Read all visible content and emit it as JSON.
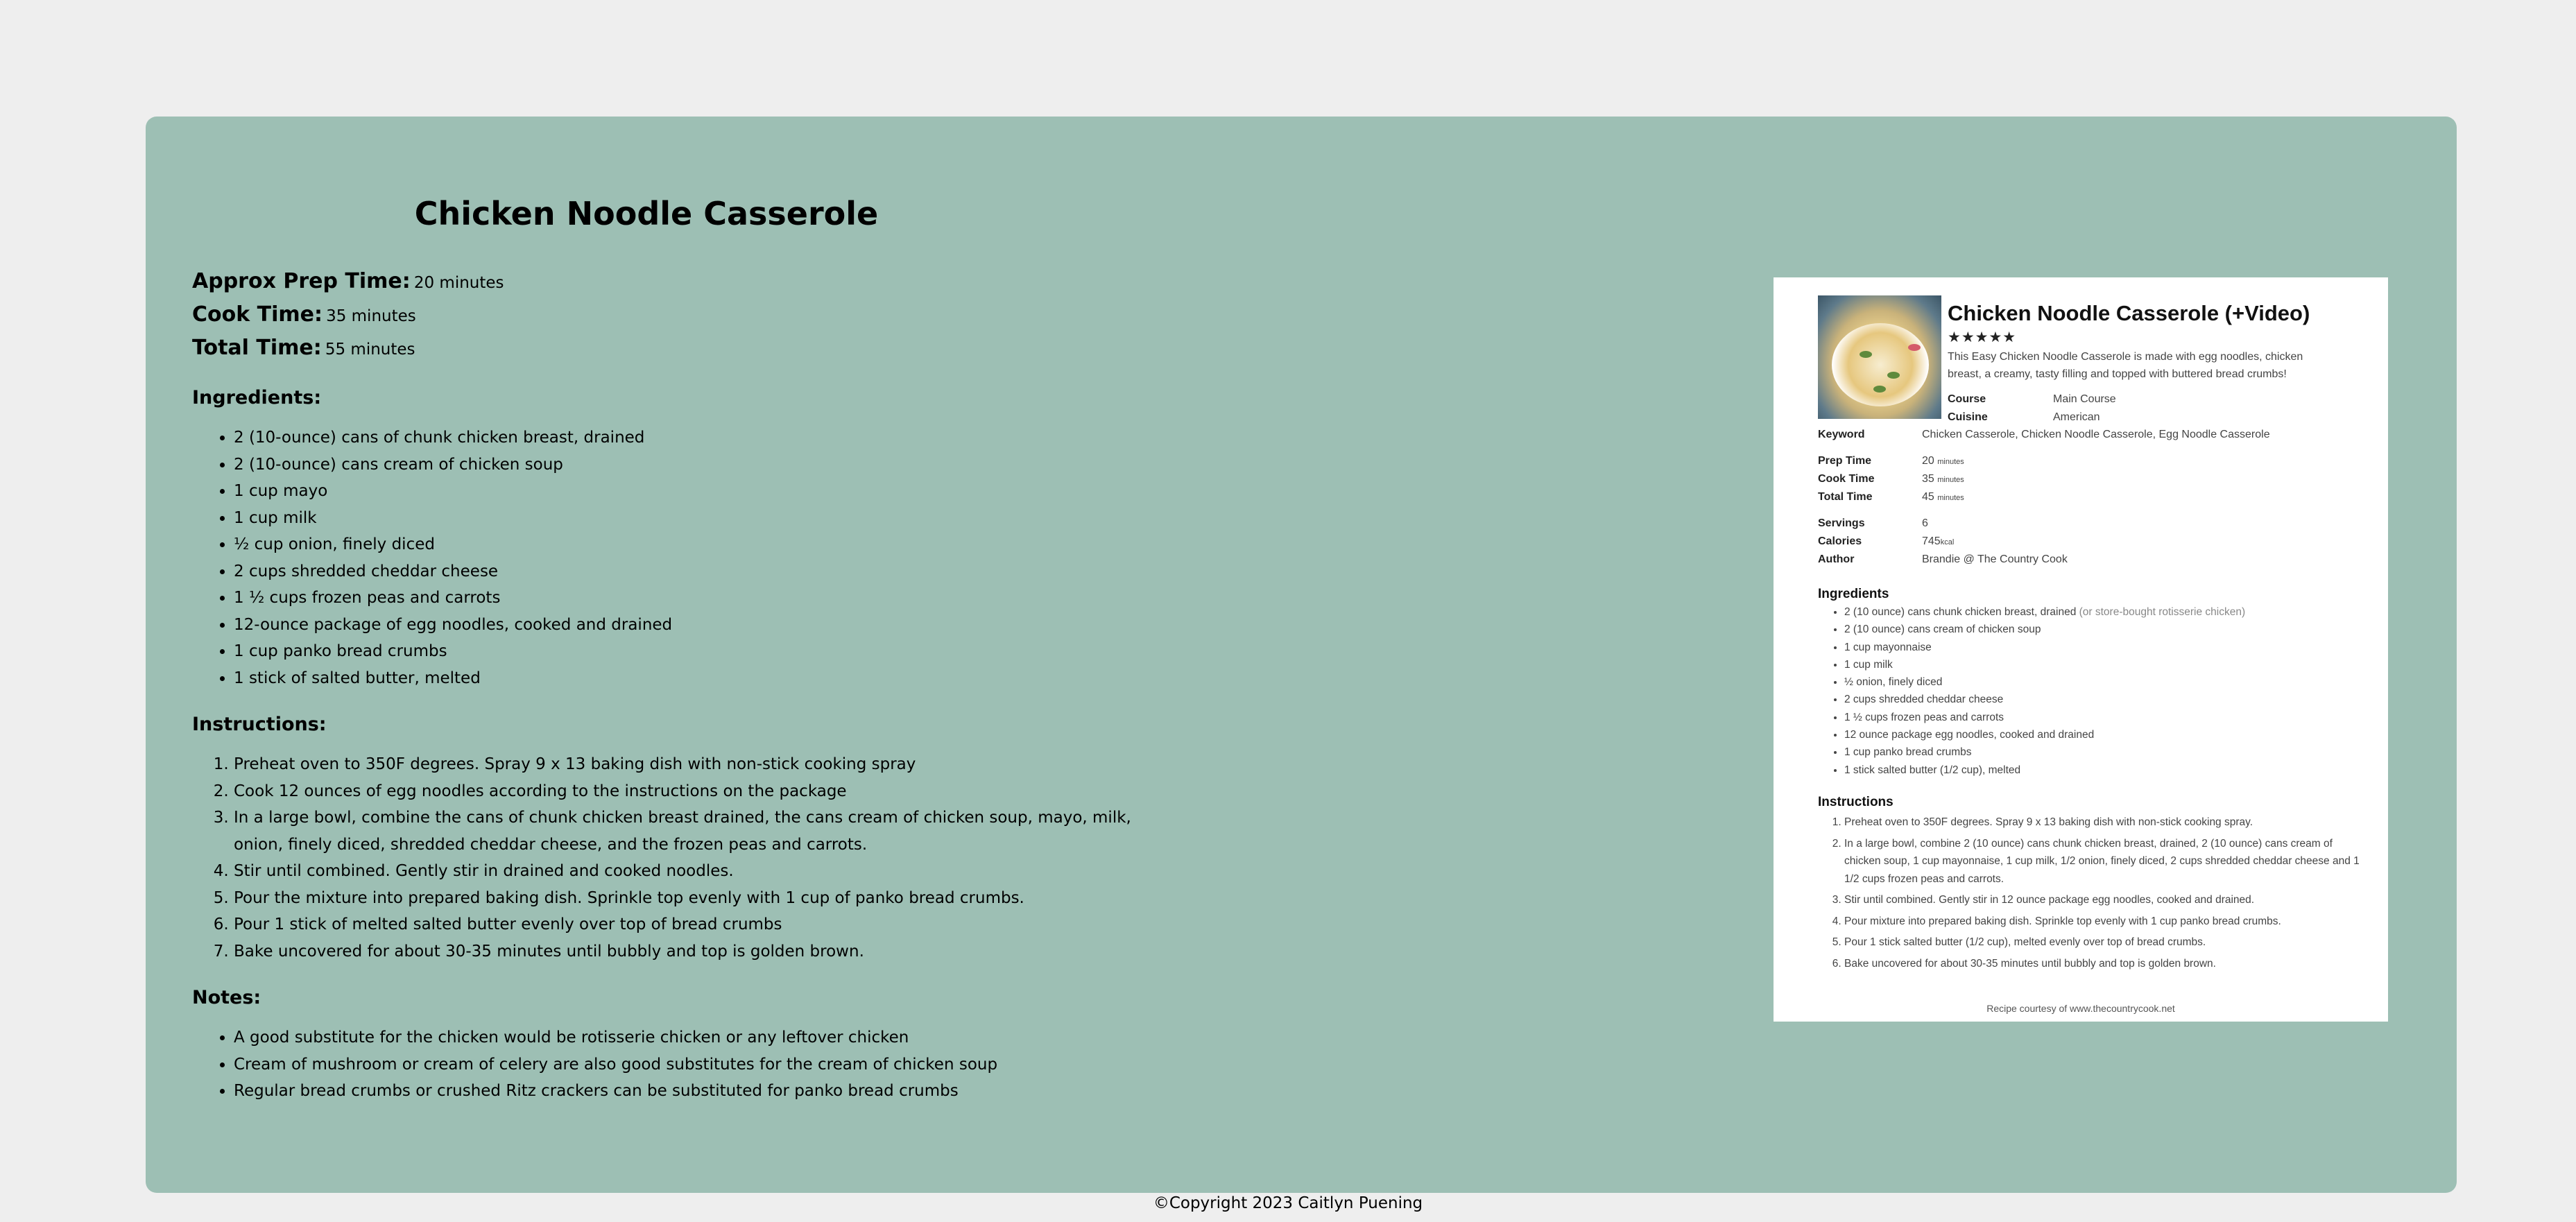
{
  "recipe": {
    "title": "Chicken Noodle Casserole",
    "times": [
      {
        "label": "Approx Prep Time:",
        "value": "20 minutes"
      },
      {
        "label": "Cook Time:",
        "value": "35 minutes"
      },
      {
        "label": "Total Time:",
        "value": "55 minutes"
      }
    ],
    "ingredients_heading": "Ingredients:",
    "ingredients": [
      "2 (10-ounce) cans of chunk chicken breast, drained",
      "2 (10-ounce) cans cream of chicken soup",
      "1 cup mayo",
      "1 cup milk",
      "½ cup onion, finely diced",
      "2 cups shredded cheddar cheese",
      "1 ½ cups frozen peas and carrots",
      "12-ounce package of egg noodles, cooked and drained",
      "1 cup panko bread crumbs",
      "1 stick of salted butter, melted"
    ],
    "instructions_heading": "Instructions:",
    "instructions": [
      "Preheat oven to 350F degrees. Spray 9 x 13 baking dish with non-stick cooking spray",
      "Cook 12 ounces of egg noodles according to the instructions on the package",
      "In a large bowl, combine the cans of chunk chicken breast drained, the cans cream of chicken soup, mayo, milk, onion, finely diced, shredded cheddar cheese, and the frozen peas and carrots.",
      "Stir until combined. Gently stir in drained and cooked noodles.",
      "Pour the mixture into prepared baking dish. Sprinkle top evenly with 1 cup of panko bread crumbs.",
      "Pour 1 stick of melted salted butter evenly over top of bread crumbs",
      "Bake uncovered for about 30-35 minutes until bubbly and top is golden brown."
    ],
    "notes_heading": "Notes:",
    "notes": [
      "A good substitute for the chicken would be rotisserie chicken or any leftover chicken",
      "Cream of mushroom or cream of celery are also good substitutes for the cream of chicken soup",
      "Regular bread crumbs or crushed Ritz crackers can be substituted for panko bread crumbs"
    ]
  },
  "card_image": {
    "title": "Chicken Noodle Casserole (+Video)",
    "stars": "★★★★★",
    "description": "This Easy Chicken Noodle Casserole is made with egg noodles, chicken breast, a creamy, tasty filling and topped with buttered bread crumbs!",
    "meta_top": [
      {
        "k": "Course",
        "v": "Main Course"
      },
      {
        "k": "Cuisine",
        "v": "American"
      }
    ],
    "keyword": {
      "k": "Keyword",
      "v": "Chicken Casserole, Chicken Noodle Casserole, Egg Noodle Casserole"
    },
    "times": [
      {
        "k": "Prep Time",
        "v": "20",
        "u": "minutes"
      },
      {
        "k": "Cook Time",
        "v": "35",
        "u": "minutes"
      },
      {
        "k": "Total Time",
        "v": "45",
        "u": "minutes"
      }
    ],
    "info": [
      {
        "k": "Servings",
        "v": "6",
        "u": ""
      },
      {
        "k": "Calories",
        "v": "745",
        "u": "kcal"
      },
      {
        "k": "Author",
        "v": "Brandie @ The Country Cook",
        "u": ""
      }
    ],
    "ingredients_heading": "Ingredients",
    "ingredients": [
      {
        "t": "2 (10 ounce) cans chunk chicken breast, drained",
        "n": "(or store-bought rotisserie chicken)"
      },
      {
        "t": "2 (10 ounce) cans cream of chicken soup",
        "n": ""
      },
      {
        "t": "1 cup mayonnaise",
        "n": ""
      },
      {
        "t": "1 cup milk",
        "n": ""
      },
      {
        "t": "½ onion, finely diced",
        "n": ""
      },
      {
        "t": "2 cups shredded cheddar cheese",
        "n": ""
      },
      {
        "t": "1 ½ cups frozen peas and carrots",
        "n": ""
      },
      {
        "t": "12 ounce package egg noodles, cooked and drained",
        "n": ""
      },
      {
        "t": "1 cup panko bread crumbs",
        "n": ""
      },
      {
        "t": "1 stick salted butter (1/2 cup), melted",
        "n": ""
      }
    ],
    "instructions_heading": "Instructions",
    "instructions": [
      "Preheat oven to 350F degrees. Spray 9 x 13 baking dish with non-stick cooking spray.",
      "In a large bowl, combine 2 (10 ounce) cans chunk chicken breast, drained, 2 (10 ounce) cans cream of chicken soup, 1 cup mayonnaise, 1 cup milk, 1/2 onion, finely diced, 2 cups shredded cheddar cheese and 1 1/2 cups frozen peas and carrots.",
      "Stir until combined. Gently stir in 12 ounce package egg noodles, cooked and drained.",
      "Pour mixture into prepared baking dish. Sprinkle top evenly with 1 cup panko bread crumbs.",
      "Pour 1 stick salted butter (1/2 cup), melted evenly over top of bread crumbs.",
      "Bake uncovered for about 30-35 minutes until bubbly and top is golden brown."
    ],
    "credit": "Recipe courtesy of www.thecountrycook.net"
  },
  "footer": {
    "copyright": "©Copyright 2023 Caitlyn Puening"
  },
  "colors": {
    "page_bg": "#eeeeee",
    "card_bg": "#9dbfb4"
  }
}
